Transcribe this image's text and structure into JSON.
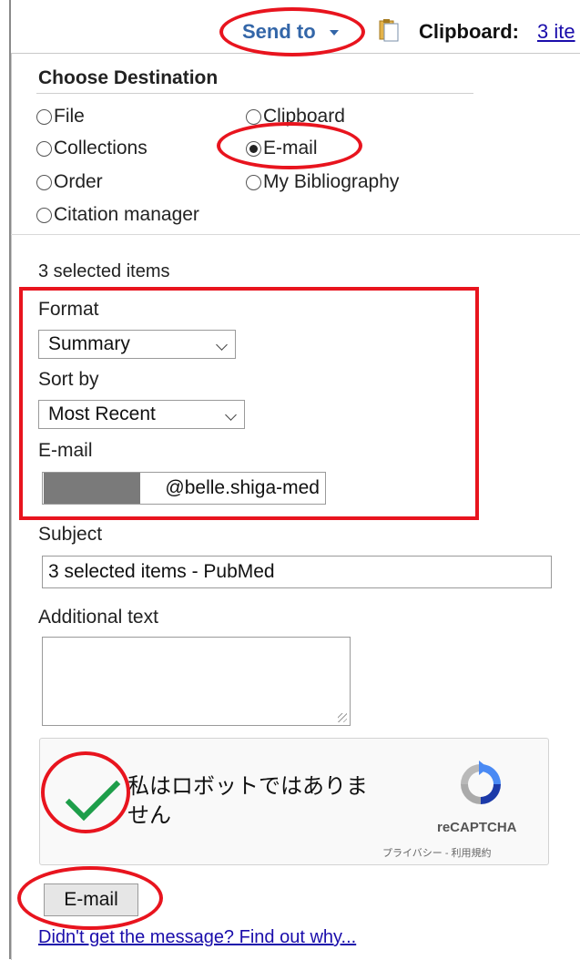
{
  "header": {
    "send_to_label": "Send to",
    "clipboard_label": "Clipboard:",
    "clipboard_count": "3 ite"
  },
  "panel": {
    "title": "Choose Destination",
    "destinations": [
      {
        "label": "File",
        "selected": false
      },
      {
        "label": "Clipboard",
        "selected": false
      },
      {
        "label": "Collections",
        "selected": false
      },
      {
        "label": "E-mail",
        "selected": true
      },
      {
        "label": "Order",
        "selected": false
      },
      {
        "label": "My Bibliography",
        "selected": false
      },
      {
        "label": "Citation manager",
        "selected": false
      }
    ]
  },
  "form": {
    "selected_count": "3 selected items",
    "format_label": "Format",
    "format_value": "Summary",
    "sort_label": "Sort by",
    "sort_value": "Most Recent",
    "email_label": "E-mail",
    "email_value": "@belle.shiga-med",
    "subject_label": "Subject",
    "subject_value": "3 selected items - PubMed",
    "additional_label": "Additional text",
    "additional_value": ""
  },
  "captcha": {
    "text": "私はロボットではありません",
    "brand": "reCAPTCHA",
    "links": "プライバシー - 利用規約",
    "checkmark_color": "#1e9e4a"
  },
  "actions": {
    "submit_label": "E-mail",
    "help_link": "Didn't get the message? Find out why..."
  },
  "colors": {
    "annotation": "#e8141e",
    "link": "#1a0dab",
    "send_to": "#3366a8"
  }
}
